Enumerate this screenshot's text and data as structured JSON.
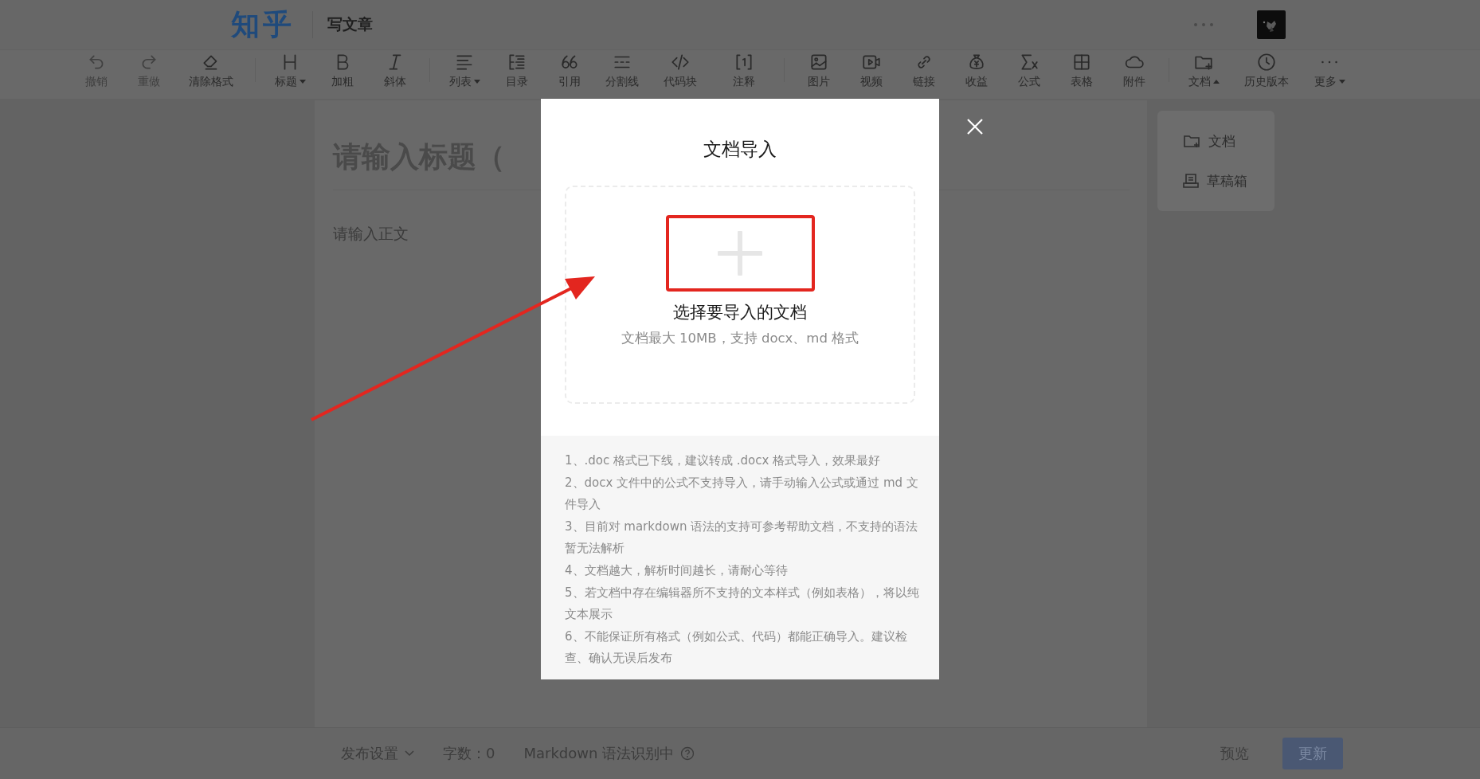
{
  "header": {
    "logo": "知乎",
    "page_title": "写文章"
  },
  "toolbar": {
    "groups": [
      [
        {
          "label": "撤销",
          "kind": "button",
          "disabled": true
        },
        {
          "label": "重做",
          "kind": "button",
          "disabled": true
        },
        {
          "label": "清除格式",
          "kind": "button",
          "disabled": false
        }
      ],
      [
        {
          "label": "标题",
          "kind": "dropdown",
          "expanded": false
        },
        {
          "label": "加粗",
          "kind": "button",
          "disabled": false
        },
        {
          "label": "斜体",
          "kind": "button",
          "disabled": false
        }
      ],
      [
        {
          "label": "列表",
          "kind": "dropdown",
          "expanded": false
        },
        {
          "label": "目录",
          "kind": "button",
          "disabled": false
        },
        {
          "label": "引用",
          "kind": "button",
          "disabled": false
        },
        {
          "label": "分割线",
          "kind": "button",
          "disabled": false
        },
        {
          "label": "代码块",
          "kind": "button",
          "disabled": false
        },
        {
          "label": "注释",
          "kind": "button",
          "disabled": false
        }
      ],
      [
        {
          "label": "图片",
          "kind": "button",
          "disabled": false
        },
        {
          "label": "视频",
          "kind": "button",
          "disabled": false
        },
        {
          "label": "链接",
          "kind": "button",
          "disabled": false
        },
        {
          "label": "收益",
          "kind": "button",
          "disabled": false
        },
        {
          "label": "公式",
          "kind": "button",
          "disabled": false
        },
        {
          "label": "表格",
          "kind": "button",
          "disabled": false
        },
        {
          "label": "附件",
          "kind": "button",
          "disabled": false
        }
      ],
      [
        {
          "label": "文档",
          "kind": "dropdown",
          "expanded": true
        },
        {
          "label": "历史版本",
          "kind": "button",
          "disabled": false
        },
        {
          "label": "更多",
          "kind": "dropdown",
          "expanded": false
        }
      ]
    ]
  },
  "doc_menu": {
    "items": [
      {
        "label": "文档"
      },
      {
        "label": "草稿箱"
      }
    ]
  },
  "editor": {
    "title_placeholder": "请输入标题（",
    "body_placeholder": "请输入正文"
  },
  "dialog": {
    "title": "文档导入",
    "upload_label": "选择要导入的文档",
    "upload_hint": "文档最大 10MB，支持 docx、md 格式",
    "notes": [
      "1、.doc 格式已下线，建议转成 .docx 格式导入，效果最好",
      "2、docx 文件中的公式不支持导入，请手动输入公式或通过 md 文件导入",
      "3、目前对 markdown 语法的支持可参考帮助文档，不支持的语法暂无法解析",
      "4、文档越大，解析时间越长，请耐心等待",
      "5、若文档中存在编辑器所不支持的文本样式（例如表格），将以纯文本展示",
      "6、不能保证所有格式（例如公式、代码）都能正确导入。建议检查、确认无误后发布"
    ]
  },
  "footer": {
    "publish_settings": "发布设置",
    "word_count": "字数：0",
    "markdown_status": "Markdown 语法识别中",
    "preview": "预览",
    "update": "更新"
  }
}
